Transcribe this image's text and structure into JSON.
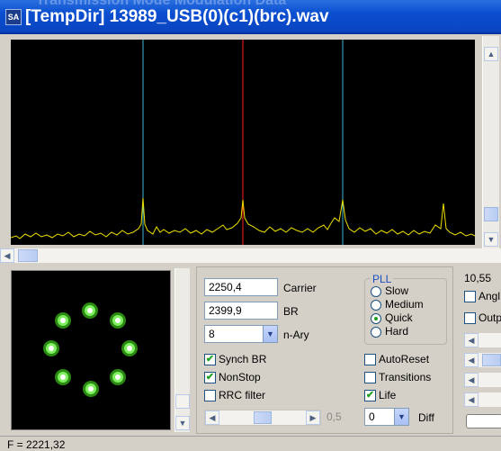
{
  "window": {
    "title": "[TempDir] 13989_USB(0)(c1)(brc).wav",
    "icon_text": "SA",
    "ghost_text": "Transmission Mode Modulation Data"
  },
  "spectrum": {
    "marker_colors": {
      "carrier": "#ff2020",
      "baud": "#3cb8d8",
      "trace": "#f0e000"
    }
  },
  "controls": {
    "carrier_value": "2250,4",
    "carrier_label": "Carrier",
    "br_value": "2399,9",
    "br_label": "BR",
    "nary_value": "8",
    "nary_label": "n-Ary",
    "pll": {
      "title": "PLL",
      "options": [
        "Slow",
        "Medium",
        "Quick",
        "Hard"
      ],
      "selected": "Quick"
    },
    "synch_br_label": "Synch BR",
    "synch_br_checked": true,
    "nonstop_label": "NonStop",
    "nonstop_checked": true,
    "rrc_label": "RRC filter",
    "rrc_checked": false,
    "autoreset_label": "AutoReset",
    "autoreset_checked": false,
    "transitions_label": "Transitions",
    "transitions_checked": false,
    "life_label": "Life",
    "life_checked": true,
    "slider_value": "0,5",
    "diff_value": "0",
    "diff_label": "Diff"
  },
  "right": {
    "readout": "10,55",
    "angle_label": "Angl",
    "output_label": "Outp"
  },
  "status": {
    "text": "F = 2221,32"
  }
}
